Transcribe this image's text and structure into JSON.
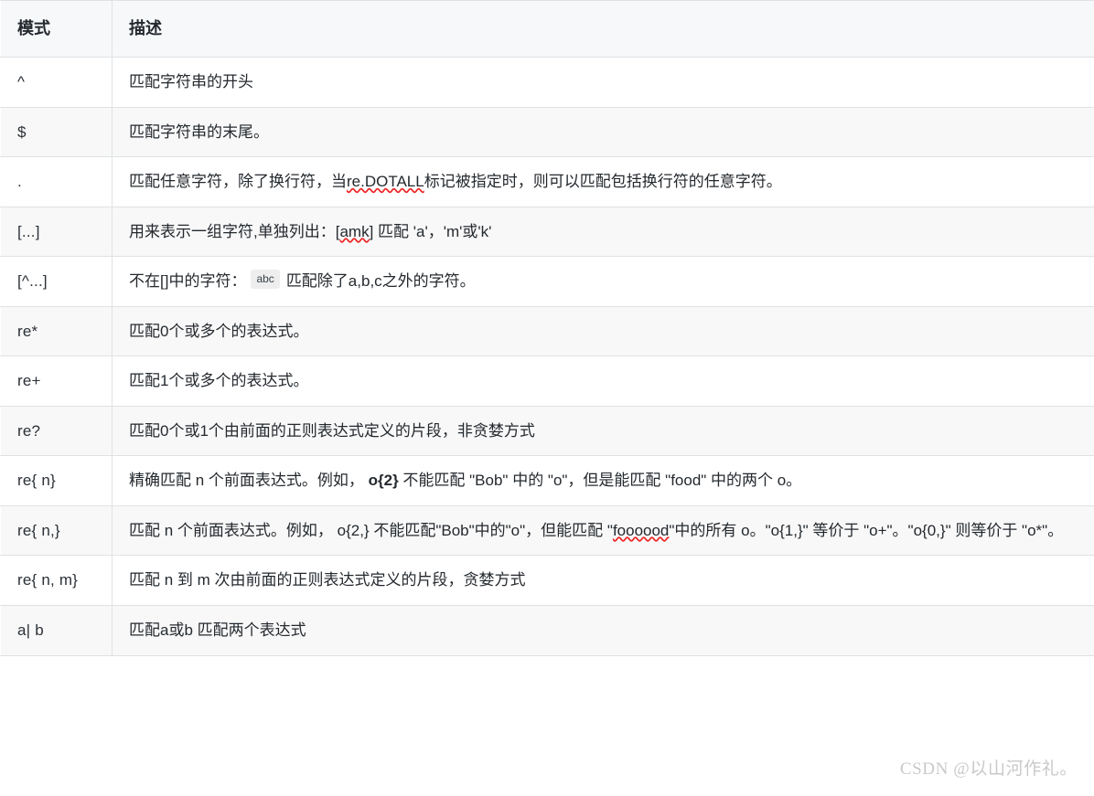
{
  "table": {
    "headers": {
      "pattern": "模式",
      "description": "描述"
    },
    "rows": [
      {
        "pattern": "^",
        "description": "匹配字符串的开头"
      },
      {
        "pattern": "$",
        "description": "匹配字符串的末尾。"
      },
      {
        "pattern": ".",
        "desc_parts": {
          "before": "匹配任意字符，除了换行符，当",
          "spell": "re.DOTALL",
          "after": "标记被指定时，则可以匹配包括换行符的任意字符。"
        }
      },
      {
        "pattern": "[...]",
        "desc_parts": {
          "before": "用来表示一组字符,单独列出：[",
          "spell": "amk",
          "after": "] 匹配 'a'，'m'或'k'"
        }
      },
      {
        "pattern": "[^...]",
        "desc_parts": {
          "before": "不在[]中的字符：",
          "chip": "abc",
          "after": "匹配除了a,b,c之外的字符。"
        }
      },
      {
        "pattern": "re*",
        "description": "匹配0个或多个的表达式。"
      },
      {
        "pattern": "re+",
        "description": "匹配1个或多个的表达式。"
      },
      {
        "pattern": "re?",
        "description": "匹配0个或1个由前面的正则表达式定义的片段，非贪婪方式"
      },
      {
        "pattern": "re{ n}",
        "desc_parts": {
          "before": "精确匹配 n 个前面表达式。例如， ",
          "bold": "o{2}",
          "after": " 不能匹配 \"Bob\" 中的 \"o\"，但是能匹配 \"food\" 中的两个 o。"
        }
      },
      {
        "pattern": "re{ n,}",
        "desc_parts": {
          "before": "匹配 n 个前面表达式。例如， o{2,} 不能匹配\"Bob\"中的\"o\"，但能匹配 \"",
          "spell": "foooood",
          "after": "\"中的所有 o。\"o{1,}\" 等价于 \"o+\"。\"o{0,}\" 则等价于 \"o*\"。"
        }
      },
      {
        "pattern": "re{ n, m}",
        "description": "匹配 n 到 m 次由前面的正则表达式定义的片段，贪婪方式"
      },
      {
        "pattern": "a| b",
        "description": "匹配a或b 匹配两个表达式"
      }
    ]
  },
  "watermark": {
    "text": "CSDN @以山河作礼。"
  },
  "colors": {
    "border": "#dfe2e5",
    "header_bg": "#f6f8fa",
    "stripe_bg": "#f8f8f8",
    "text": "#24292e",
    "spellcheck": "#ee2222",
    "chip_bg": "#eeeeee",
    "watermark": "#c9c9c9"
  }
}
